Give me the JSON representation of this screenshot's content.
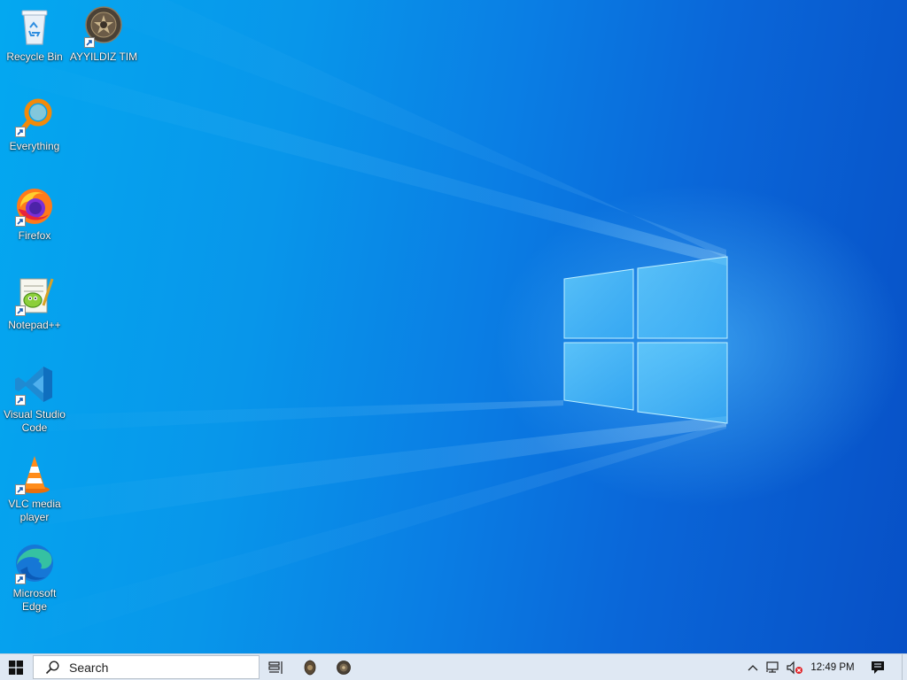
{
  "desktop": {
    "icons": [
      {
        "id": "recycle-bin",
        "label": "Recycle Bin",
        "icon": "recycle-bin-icon",
        "shortcut": false
      },
      {
        "id": "ayyildiz-tim",
        "label": "AYYILDIZ TIM",
        "icon": "ayyildiz-emblem-icon",
        "shortcut": true
      },
      {
        "id": "everything",
        "label": "Everything",
        "icon": "everything-search-icon",
        "shortcut": true
      },
      {
        "id": "firefox",
        "label": "Firefox",
        "icon": "firefox-icon",
        "shortcut": true
      },
      {
        "id": "notepad-plus-plus",
        "label": "Notepad++",
        "icon": "notepad-plus-plus-icon",
        "shortcut": true
      },
      {
        "id": "vscode",
        "label": "Visual Studio Code",
        "icon": "vscode-icon",
        "shortcut": true
      },
      {
        "id": "vlc",
        "label": "VLC media player",
        "icon": "vlc-cone-icon",
        "shortcut": true
      },
      {
        "id": "edge",
        "label": "Microsoft Edge",
        "icon": "edge-icon",
        "shortcut": true
      }
    ]
  },
  "taskbar": {
    "start": {
      "icon": "windows-logo-icon"
    },
    "search": {
      "placeholder": "Search",
      "icon": "search-icon"
    },
    "task_view": {
      "icon": "task-view-icon"
    },
    "pinned": [
      {
        "id": "ayyildiz-app-1",
        "icon": "ayyildiz-emblem-icon"
      },
      {
        "id": "ayyildiz-app-2",
        "icon": "ayyildiz-emblem-icon"
      }
    ],
    "tray": {
      "chevron_icon": "chevron-up-icon",
      "network_icon": "network-disconnected-icon",
      "volume_icon": "speaker-muted-icon",
      "time": "12:49 PM",
      "notifications_icon": "action-center-icon"
    }
  },
  "colors": {
    "wallpaper_light": "#04a8f0",
    "wallpaper_dark": "#0750c6",
    "taskbar": "#dfe8f3"
  }
}
